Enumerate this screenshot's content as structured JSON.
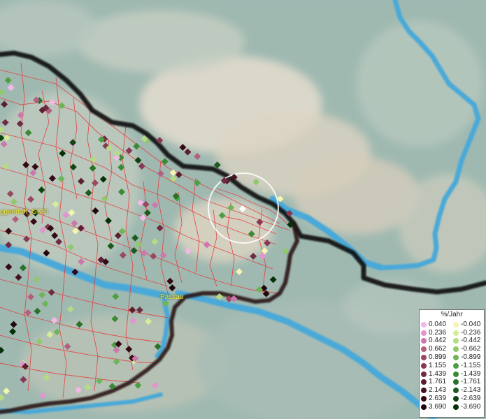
{
  "map": {
    "labels": {
      "deggendorf": "ggendorf_GKSt",
      "passau": "Passau"
    }
  },
  "legend": {
    "title": "%/Jahr",
    "positive": [
      {
        "value": "0.040",
        "color": "#f2b8e6"
      },
      {
        "value": "0.236",
        "color": "#e394cf"
      },
      {
        "value": "0.442",
        "color": "#cd77ad"
      },
      {
        "value": "0.662",
        "color": "#b2607f"
      },
      {
        "value": "0.899",
        "color": "#9a4860"
      },
      {
        "value": "1.155",
        "color": "#853953"
      },
      {
        "value": "1.439",
        "color": "#702b42"
      },
      {
        "value": "1.761",
        "color": "#5c1f30"
      },
      {
        "value": "2.143",
        "color": "#471322"
      },
      {
        "value": "2.639",
        "color": "#330b16"
      },
      {
        "value": "3.690",
        "color": "#1f050c"
      }
    ],
    "negative": [
      {
        "value": "-0.040",
        "color": "#f2f6b0"
      },
      {
        "value": "-0.236",
        "color": "#d5ec99"
      },
      {
        "value": "-0.442",
        "color": "#b5dc85"
      },
      {
        "value": "-0.662",
        "color": "#90c86c"
      },
      {
        "value": "-0.899",
        "color": "#6fb558"
      },
      {
        "value": "-1.155",
        "color": "#4f9e44"
      },
      {
        "value": "-1.439",
        "color": "#3b8a36"
      },
      {
        "value": "-1.761",
        "color": "#2a7229"
      },
      {
        "value": "-2.143",
        "color": "#1c5a1d"
      },
      {
        "value": "-2.639",
        "color": "#104312"
      },
      {
        "value": "-3.690",
        "color": "#063008"
      }
    ]
  },
  "colors": {
    "border": "#1a1a1a",
    "district_lines": "#e83a3a",
    "rivers": "#4aa9d8",
    "label": "#f2e63a"
  }
}
